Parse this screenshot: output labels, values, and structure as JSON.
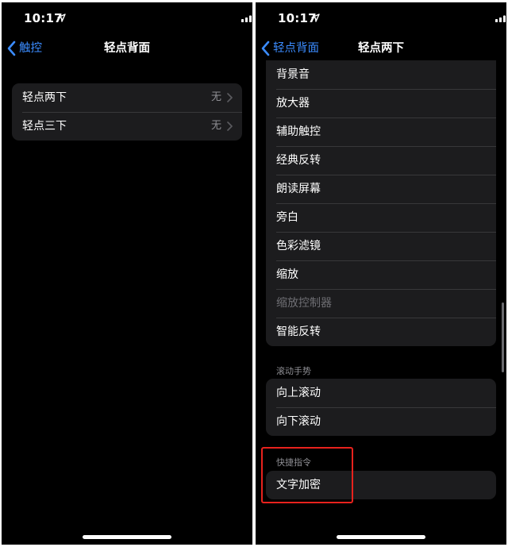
{
  "left": {
    "status": {
      "time": "10:17"
    },
    "nav": {
      "back_label": "触控",
      "title": "轻点背面"
    },
    "items": [
      {
        "label": "轻点两下",
        "value": "无"
      },
      {
        "label": "轻点三下",
        "value": "无"
      }
    ]
  },
  "right": {
    "status": {
      "time": "10:17"
    },
    "nav": {
      "back_label": "轻点背面",
      "title": "轻点两下"
    },
    "accessibility_items": [
      {
        "label": "背景音"
      },
      {
        "label": "放大器"
      },
      {
        "label": "辅助触控"
      },
      {
        "label": "经典反转"
      },
      {
        "label": "朗读屏幕"
      },
      {
        "label": "旁白"
      },
      {
        "label": "色彩滤镜"
      },
      {
        "label": "缩放"
      },
      {
        "label": "缩放控制器",
        "disabled": true
      },
      {
        "label": "智能反转"
      }
    ],
    "scroll_section": {
      "header": "滚动手势",
      "items": [
        {
          "label": "向上滚动"
        },
        {
          "label": "向下滚动"
        }
      ]
    },
    "shortcuts_section": {
      "header": "快捷指令",
      "items": [
        {
          "label": "文字加密"
        }
      ]
    }
  },
  "colors": {
    "accent": "#3b8cff",
    "background": "#000000",
    "cell": "#1c1c1e",
    "highlight": "#e8221d"
  },
  "icons": [
    "location-arrow-icon",
    "cellular-signal-icon",
    "wifi-icon",
    "battery-icon",
    "chevron-left-icon",
    "chevron-right-icon"
  ]
}
